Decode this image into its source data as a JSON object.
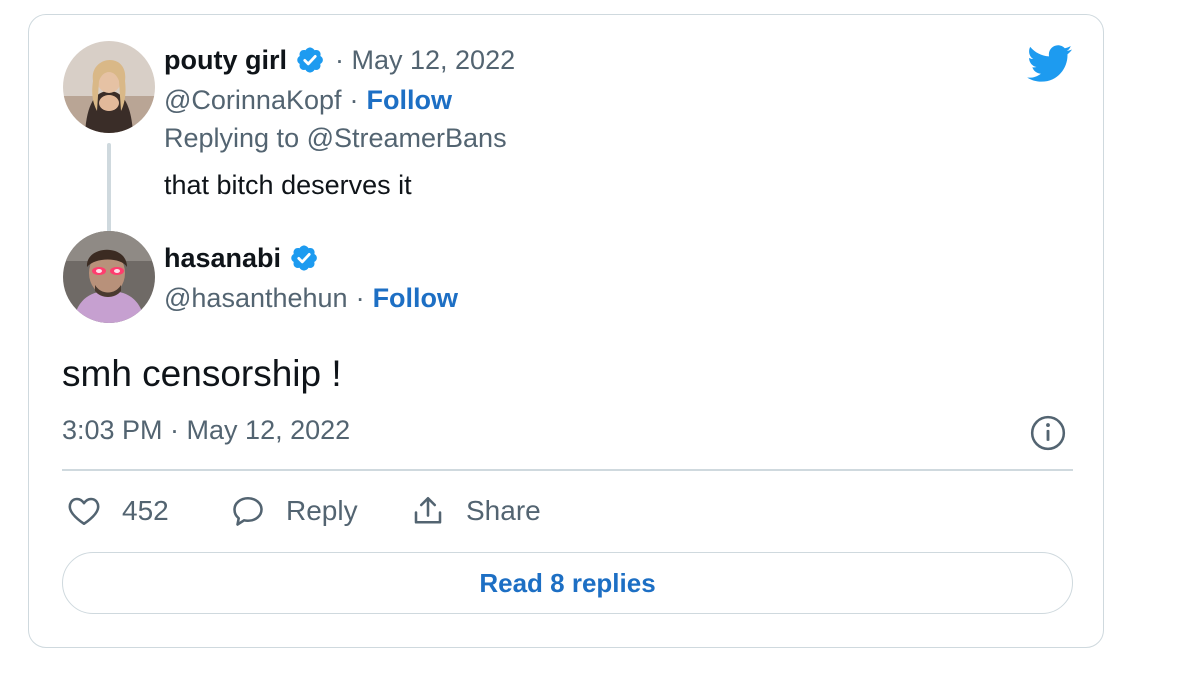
{
  "reply_tweet": {
    "author_name": "pouty girl",
    "date": "· May 12, 2022",
    "handle": "@CorinnaKopf",
    "separator": "·",
    "follow_label": "Follow",
    "replying_to": "Replying to @StreamerBans",
    "text": "that bitch deserves it"
  },
  "main_tweet": {
    "author_name": "hasanabi",
    "handle": "@hasanthehun",
    "separator": "·",
    "follow_label": "Follow",
    "text": "smh censorship !",
    "timestamp": "3:03 PM · May 12, 2022"
  },
  "actions": {
    "like_count": "452",
    "reply_label": "Reply",
    "share_label": "Share"
  },
  "read_replies_label": "Read 8 replies",
  "colors": {
    "accent_blue": "#1d9bf0",
    "link_blue": "#1d6fc4",
    "muted_text": "#536471",
    "border": "#cfd9de"
  },
  "icons": [
    "twitter-bird-icon",
    "verified-badge-icon",
    "info-icon",
    "heart-icon",
    "reply-bubble-icon",
    "share-icon"
  ]
}
